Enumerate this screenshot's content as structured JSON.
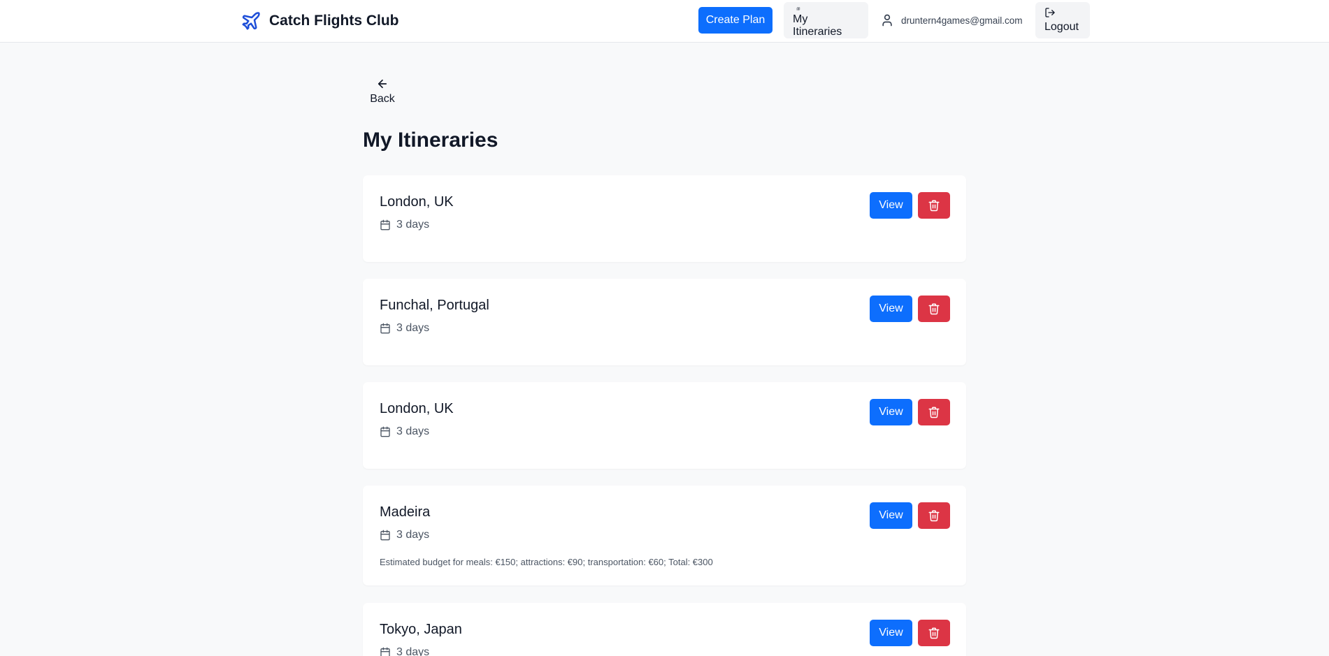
{
  "header": {
    "brand_name": "Catch Flights Club",
    "create_plan_label": "Create Plan",
    "my_itineraries_label": "My Itineraries",
    "user_email": "druntern4games@gmail.com",
    "logout_label": "Logout"
  },
  "page": {
    "back_label": "Back",
    "title": "My Itineraries"
  },
  "itineraries": [
    {
      "destination": "London, UK",
      "duration": "3 days",
      "budget_note": ""
    },
    {
      "destination": "Funchal, Portugal",
      "duration": "3 days",
      "budget_note": ""
    },
    {
      "destination": "London, UK",
      "duration": "3 days",
      "budget_note": ""
    },
    {
      "destination": "Madeira",
      "duration": "3 days",
      "budget_note": "Estimated budget for meals: €150; attractions: €90; transportation: €60; Total: €300"
    },
    {
      "destination": "Tokyo, Japan",
      "duration": "3 days",
      "budget_note": ""
    }
  ],
  "actions": {
    "view_label": "View"
  },
  "colors": {
    "primary": "#0d6efd",
    "danger": "#dc3545",
    "brand_icon": "#1d4ed8",
    "page_background": "#f8f9fa"
  },
  "icons": {
    "brand": "airplane-icon",
    "itineraries": "map-icon",
    "user": "user-icon",
    "logout": "logout-icon",
    "back": "arrow-left-icon",
    "duration": "calendar-icon",
    "delete": "trash-icon"
  }
}
